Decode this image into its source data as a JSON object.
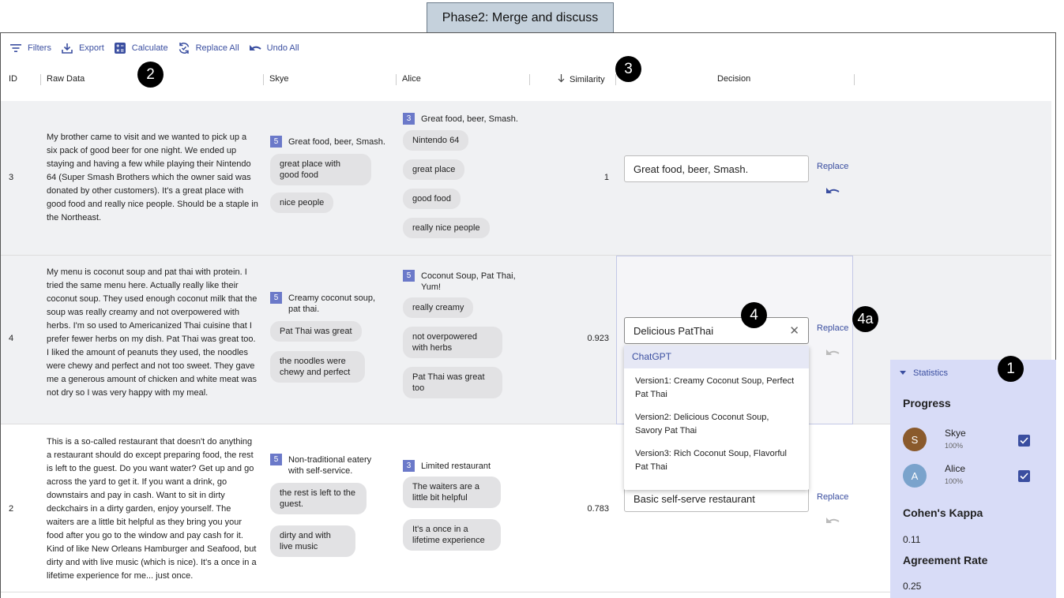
{
  "banner": "Phase2: Merge and discuss",
  "toolbar": {
    "filters": "Filters",
    "export": "Export",
    "calculate": "Calculate",
    "replace_all": "Replace All",
    "undo_all": "Undo All"
  },
  "columns": {
    "id": "ID",
    "raw": "Raw Data",
    "skye": "Skye",
    "alice": "Alice",
    "similarity": "Similarity",
    "decision": "Decision"
  },
  "rows": [
    {
      "id": "3",
      "raw": "My brother came to visit and we wanted to pick up a six pack of good beer for one night. We ended up staying and having a few while playing their Nintendo 64 (Super Smash Brothers which the owner said was donated by other customers). It's a great place with good food and really nice people. Should be a staple in the Northeast.",
      "skye_count": "5",
      "skye_summary": "Great food, beer, Smash.",
      "skye_chips": [
        "great place with good food",
        "nice people"
      ],
      "alice_count": "3",
      "alice_summary": "Great food, beer, Smash.",
      "alice_chips": [
        "Nintendo 64",
        "great place",
        "good food",
        "really nice people"
      ],
      "similarity": "1",
      "decision": "Great food, beer, Smash.",
      "replace": "Replace"
    },
    {
      "id": "4",
      "raw": "My menu is coconut soup and pat thai with protein. I tried the same menu here. Actually really like their coconut soup. They used enough coconut milk that the soup was really creamy and not overpowered with herbs. I'm so used to Americanized Thai cuisine that I prefer fewer herbs on my dish. Pat Thai was great too. I liked the amount of peanuts they used, the noodles were chewy and perfect and not too sweet. They gave me a generous amount of chicken and white meat was not dry so I was very happy with my meal.",
      "skye_count": "5",
      "skye_summary": "Creamy coconut soup, pat thai.",
      "skye_chips": [
        "Pat Thai was great",
        "the noodles were chewy and perfect"
      ],
      "alice_count": "5",
      "alice_summary": "Coconut Soup, Pat Thai, Yum!",
      "alice_chips": [
        "really creamy",
        "not overpowered with herbs",
        "Pat Thai was great too"
      ],
      "similarity": "0.923",
      "decision": "Delicious PatThai",
      "replace": "Replace"
    },
    {
      "id": "2",
      "raw": "This is a so-called restaurant that doesn't do anything a restaurant should do except preparing food, the rest is left to the guest. Do you want water? Get up and go across the yard to get it. If you want a drink, go downstairs and pay in cash. Want to sit in dirty deckchairs in a dirty garden, enjoy yourself. The waiters are a little bit helpful as they bring you your food after you go to the window and pay cash for it. Kind of like New Orleans Hamburger and Seafood, but dirty and with live music (which is nice). It's a once in a lifetime experience for me... just once.",
      "skye_count": "5",
      "skye_summary": "Non-traditional eatery with self-service.",
      "skye_chips": [
        "the rest is left to the guest.",
        "dirty and with live music"
      ],
      "alice_count": "3",
      "alice_summary": "Limited restaurant",
      "alice_chips": [
        "The waiters are a little bit helpful",
        "It's a once in a lifetime experience"
      ],
      "similarity": "0.783",
      "decision": "Basic self-serve restaurant",
      "replace": "Replace"
    }
  ],
  "dropdown": {
    "header": "ChatGPT",
    "options": [
      "Version1: Creamy Coconut Soup, Perfect Pat Thai",
      "Version2: Delicious Coconut Soup, Savory Pat Thai",
      "Version3: Rich Coconut Soup, Flavorful Pat Thai"
    ]
  },
  "statistics": {
    "title": "Statistics",
    "progress_label": "Progress",
    "users": [
      {
        "initial": "S",
        "name": "Skye",
        "pct": "100%",
        "color": "#8a5a2c"
      },
      {
        "initial": "A",
        "name": "Alice",
        "pct": "100%",
        "color": "#7aa3cc"
      }
    ],
    "kappa_label": "Cohen's Kappa",
    "kappa_value": "0.11",
    "agreement_label": "Agreement Rate",
    "agreement_value": "0.25"
  },
  "markers": {
    "m1": "1",
    "m2": "2",
    "m3": "3",
    "m4": "4",
    "m4a": "4a"
  },
  "colors": {
    "accent": "#3a4ea0",
    "badge": "#6b79c9",
    "stats_bg": "#d8dcf7",
    "row_gray": "#f0f1f3"
  }
}
